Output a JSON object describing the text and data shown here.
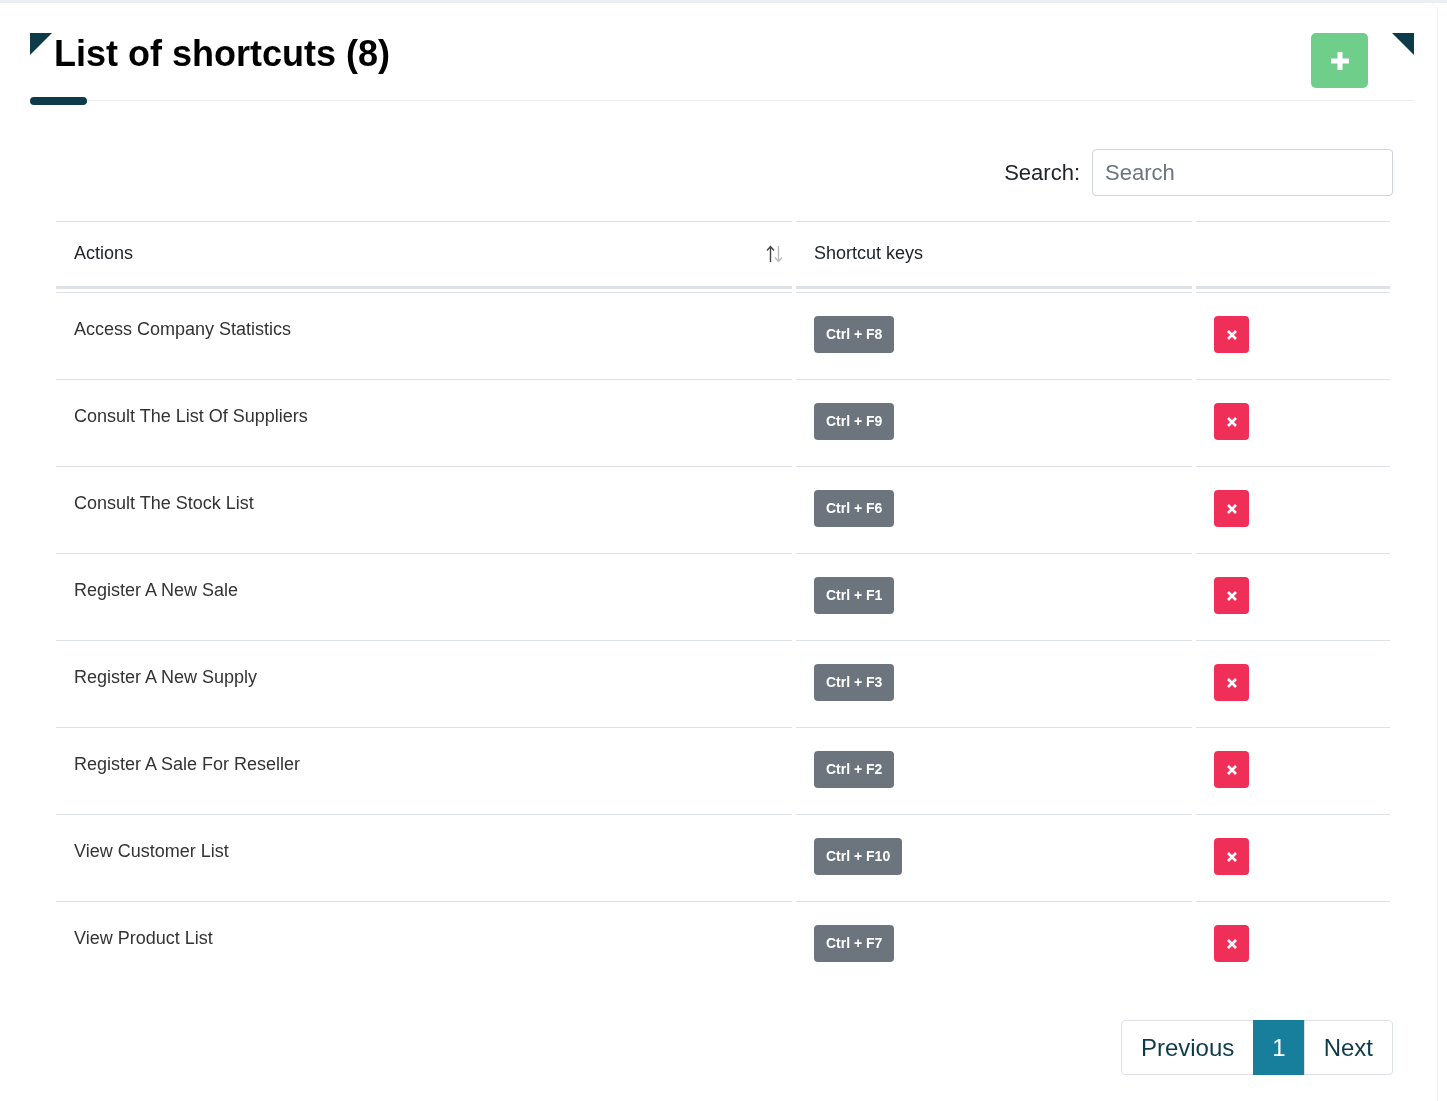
{
  "header": {
    "title": "List of shortcuts (8)"
  },
  "search": {
    "label": "Search:",
    "placeholder": "Search"
  },
  "table": {
    "columns": [
      {
        "label": "Actions",
        "sortable": true
      },
      {
        "label": "Shortcut keys",
        "sortable": false
      }
    ],
    "rows": [
      {
        "action": "Access Company Statistics",
        "shortcut": "Ctrl + F8"
      },
      {
        "action": "Consult The List Of Suppliers",
        "shortcut": "Ctrl + F9"
      },
      {
        "action": "Consult The Stock List",
        "shortcut": "Ctrl + F6"
      },
      {
        "action": "Register A New Sale",
        "shortcut": "Ctrl + F1"
      },
      {
        "action": "Register A New Supply",
        "shortcut": "Ctrl + F3"
      },
      {
        "action": "Register A Sale For Reseller",
        "shortcut": "Ctrl + F2"
      },
      {
        "action": "View Customer List",
        "shortcut": "Ctrl + F10"
      },
      {
        "action": "View Product List",
        "shortcut": "Ctrl + F7"
      }
    ]
  },
  "pagination": {
    "previous": "Previous",
    "pages": [
      {
        "label": "1",
        "selected": true
      }
    ],
    "next": "Next"
  }
}
